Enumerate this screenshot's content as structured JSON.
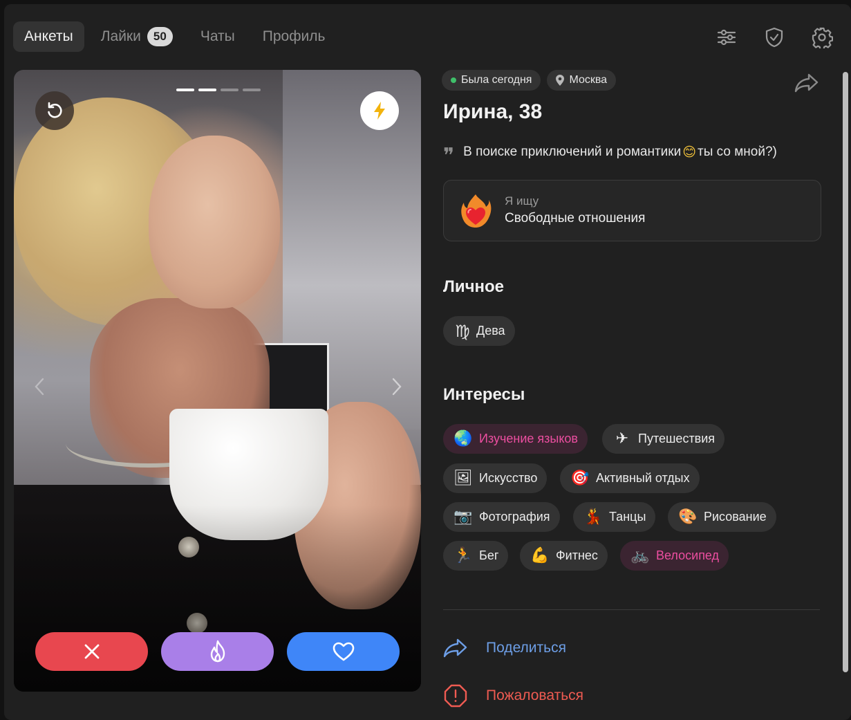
{
  "nav": {
    "tabs": [
      {
        "label": "Анкеты",
        "active": true
      },
      {
        "label": "Лайки",
        "badge": "50"
      },
      {
        "label": "Чаты"
      },
      {
        "label": "Профиль"
      }
    ]
  },
  "top_icons": [
    "filters-icon",
    "shield-icon",
    "gear-icon"
  ],
  "photo": {
    "pages_total": 4,
    "current_page": 2
  },
  "actions": {
    "dislike_icon": "close-icon",
    "superlike_icon": "flame-icon",
    "like_icon": "heart-icon"
  },
  "profile": {
    "status": "Была сегодня",
    "city": "Москва",
    "name_age": "Ирина, 38",
    "bio_before": "В поиске приключений и романтики",
    "bio_emoji": "😊",
    "bio_after": "ты со мной?)",
    "seeking_label": "Я ищу",
    "seeking_value": "Свободные отношения",
    "personal_title": "Личное",
    "personal": [
      {
        "icon": "virgo-icon",
        "glyph": "♍",
        "label": "Дева"
      }
    ],
    "interests_title": "Интересы",
    "interests": [
      {
        "glyph": "🌏",
        "label": "Изучение языков",
        "highlight": true
      },
      {
        "glyph": "✈",
        "label": "Путешествия",
        "highlight": false
      },
      {
        "glyph": "🖼",
        "label": "Искусство",
        "highlight": false
      },
      {
        "glyph": "🎯",
        "label": "Активный отдых",
        "highlight": false
      },
      {
        "glyph": "📷",
        "label": "Фотография",
        "highlight": false
      },
      {
        "glyph": "💃",
        "label": "Танцы",
        "highlight": false
      },
      {
        "glyph": "🎨",
        "label": "Рисование",
        "highlight": false
      },
      {
        "glyph": "🏃",
        "label": "Бег",
        "highlight": false
      },
      {
        "glyph": "💪",
        "label": "Фитнес",
        "highlight": false
      },
      {
        "glyph": "🚲",
        "label": "Велосипед",
        "highlight": true
      }
    ],
    "share_label": "Поделиться",
    "report_label": "Пожаловаться"
  },
  "colors": {
    "accent_pink": "#ec4ea0",
    "like_blue": "#3f86f8",
    "dislike_red": "#e8474f",
    "superlike_purple": "#a97fe8",
    "online_green": "#3fc06a"
  }
}
